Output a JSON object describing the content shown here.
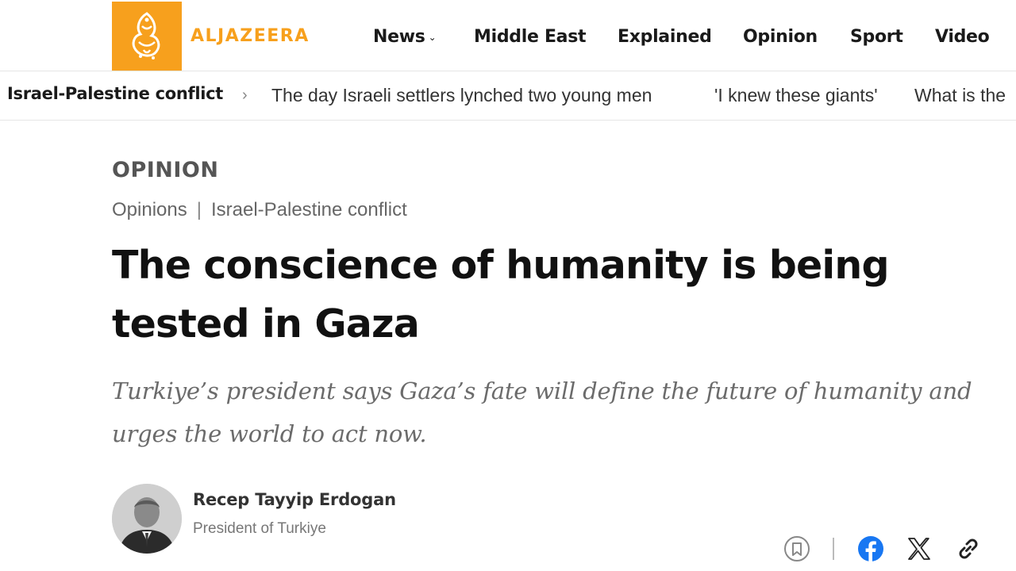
{
  "brand": {
    "wordmark": "ALJAZEERA",
    "accent_color": "#f7a01d"
  },
  "nav": {
    "items": [
      {
        "label": "News",
        "has_dropdown": true
      },
      {
        "label": "Middle East"
      },
      {
        "label": "Explained"
      },
      {
        "label": "Opinion"
      },
      {
        "label": "Sport"
      },
      {
        "label": "Video"
      }
    ]
  },
  "trending": {
    "topic": "Israel-Palestine conflict",
    "links": [
      "The day Israeli settlers lynched two young men",
      "'I knew these giants'",
      "What is the"
    ]
  },
  "article": {
    "kicker": "OPINION",
    "breadcrumb": [
      "Opinions",
      "Israel-Palestine conflict"
    ],
    "breadcrumb_separator": "|",
    "headline": "The conscience of humanity is being tested in Gaza",
    "dek": "Turkiye’s president says Gaza’s fate will define the future of humanity and urges the world to act now.",
    "author": {
      "name": "Recep Tayyip Erdogan",
      "role": "President of Turkiye"
    }
  },
  "share": {
    "icons": [
      "save-icon",
      "facebook-icon",
      "x-icon",
      "link-icon"
    ],
    "facebook_color": "#1877f2"
  }
}
